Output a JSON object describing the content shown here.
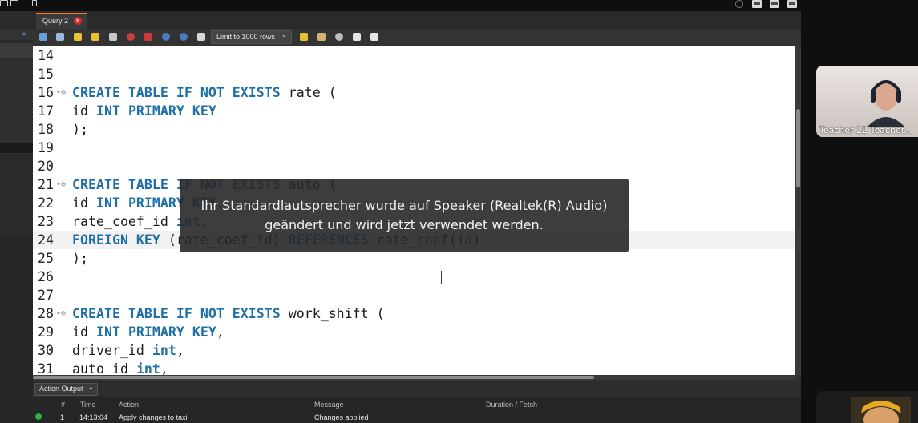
{
  "tab": {
    "label": "Query 2",
    "close_glyph": "×"
  },
  "toolbar": {
    "limit_label": "Limit to 1000 rows",
    "icons": [
      "open-folder-icon",
      "save-icon",
      "execute-icon",
      "execute-current-icon",
      "explain-icon",
      "stop-icon",
      "toggle-error-icon",
      "commit-icon",
      "rollback-icon",
      "autocommit-icon",
      "beautify-icon",
      "find-icon",
      "invisible-chars-icon",
      "wrap-icon"
    ]
  },
  "editor": {
    "lines": [
      {
        "n": "14",
        "fold": "",
        "tokens": []
      },
      {
        "n": "15",
        "fold": "",
        "tokens": []
      },
      {
        "n": "16",
        "fold": "•⊖",
        "tokens": [
          {
            "t": "CREATE TABLE IF NOT EXISTS",
            "k": 1
          },
          {
            "t": " rate (",
            "k": 0
          }
        ]
      },
      {
        "n": "17",
        "fold": "",
        "tokens": [
          {
            "t": "id ",
            "k": 0
          },
          {
            "t": "INT PRIMARY KEY",
            "k": 1
          }
        ]
      },
      {
        "n": "18",
        "fold": "",
        "tokens": [
          {
            "t": ");",
            "k": 0
          }
        ]
      },
      {
        "n": "19",
        "fold": "",
        "tokens": []
      },
      {
        "n": "20",
        "fold": "",
        "tokens": []
      },
      {
        "n": "21",
        "fold": "•⊖",
        "tokens": [
          {
            "t": "CREATE TABLE IF NOT EXISTS",
            "k": 1
          },
          {
            "t": " auto (",
            "k": 0
          }
        ]
      },
      {
        "n": "22",
        "fold": "",
        "tokens": [
          {
            "t": "id ",
            "k": 0
          },
          {
            "t": "INT PRIMARY KEY",
            "k": 1
          },
          {
            "t": ",",
            "k": 0
          }
        ]
      },
      {
        "n": "23",
        "fold": "",
        "tokens": [
          {
            "t": "rate_coef_id ",
            "k": 0
          },
          {
            "t": "int",
            "k": 1
          },
          {
            "t": ",",
            "k": 0
          }
        ]
      },
      {
        "n": "24",
        "fold": "",
        "current": true,
        "tokens": [
          {
            "t": "FOREIGN KEY",
            "k": 1
          },
          {
            "t": " (rate_coef_id) ",
            "k": 0
          },
          {
            "t": "REFERENCES",
            "k": 1
          },
          {
            "t": " rate_coef(id)",
            "k": 0
          }
        ]
      },
      {
        "n": "25",
        "fold": "",
        "tokens": [
          {
            "t": ");",
            "k": 0
          }
        ]
      },
      {
        "n": "26",
        "fold": "",
        "tokens": []
      },
      {
        "n": "27",
        "fold": "",
        "tokens": []
      },
      {
        "n": "28",
        "fold": "•⊖",
        "tokens": [
          {
            "t": "CREATE TABLE IF NOT EXISTS",
            "k": 1
          },
          {
            "t": " work_shift (",
            "k": 0
          }
        ]
      },
      {
        "n": "29",
        "fold": "",
        "tokens": [
          {
            "t": "id ",
            "k": 0
          },
          {
            "t": "INT PRIMARY KEY",
            "k": 1
          },
          {
            "t": ",",
            "k": 0
          }
        ]
      },
      {
        "n": "30",
        "fold": "",
        "tokens": [
          {
            "t": "driver_id ",
            "k": 0
          },
          {
            "t": "int",
            "k": 1
          },
          {
            "t": ",",
            "k": 0
          }
        ]
      },
      {
        "n": "31",
        "fold": "",
        "tokens": [
          {
            "t": "auto_id ",
            "k": 0
          },
          {
            "t": "int",
            "k": 1
          },
          {
            "t": ",",
            "k": 0
          }
        ]
      }
    ]
  },
  "output": {
    "select_label": "Action Output",
    "columns": [
      "#",
      "Time",
      "Action",
      "Message",
      "Duration / Fetch"
    ],
    "rows": [
      {
        "num": "1",
        "time": "14:13:04",
        "action": "Apply changes to taxi",
        "message": "Changes applied",
        "duration": ""
      }
    ]
  },
  "toast": {
    "line1": "Ihr Standardlautsprecher wurde auf Speaker (Realtek(R) Audio)",
    "line2": "geändert und wird jetzt verwendet werden."
  },
  "video": {
    "name": "Teacher 22 Teacher..."
  },
  "colors": {
    "keyword": "#1f6fa8",
    "tab_accent": "#ff7a1a",
    "close_red": "#e0242b",
    "status_ok": "#2bb24c"
  }
}
